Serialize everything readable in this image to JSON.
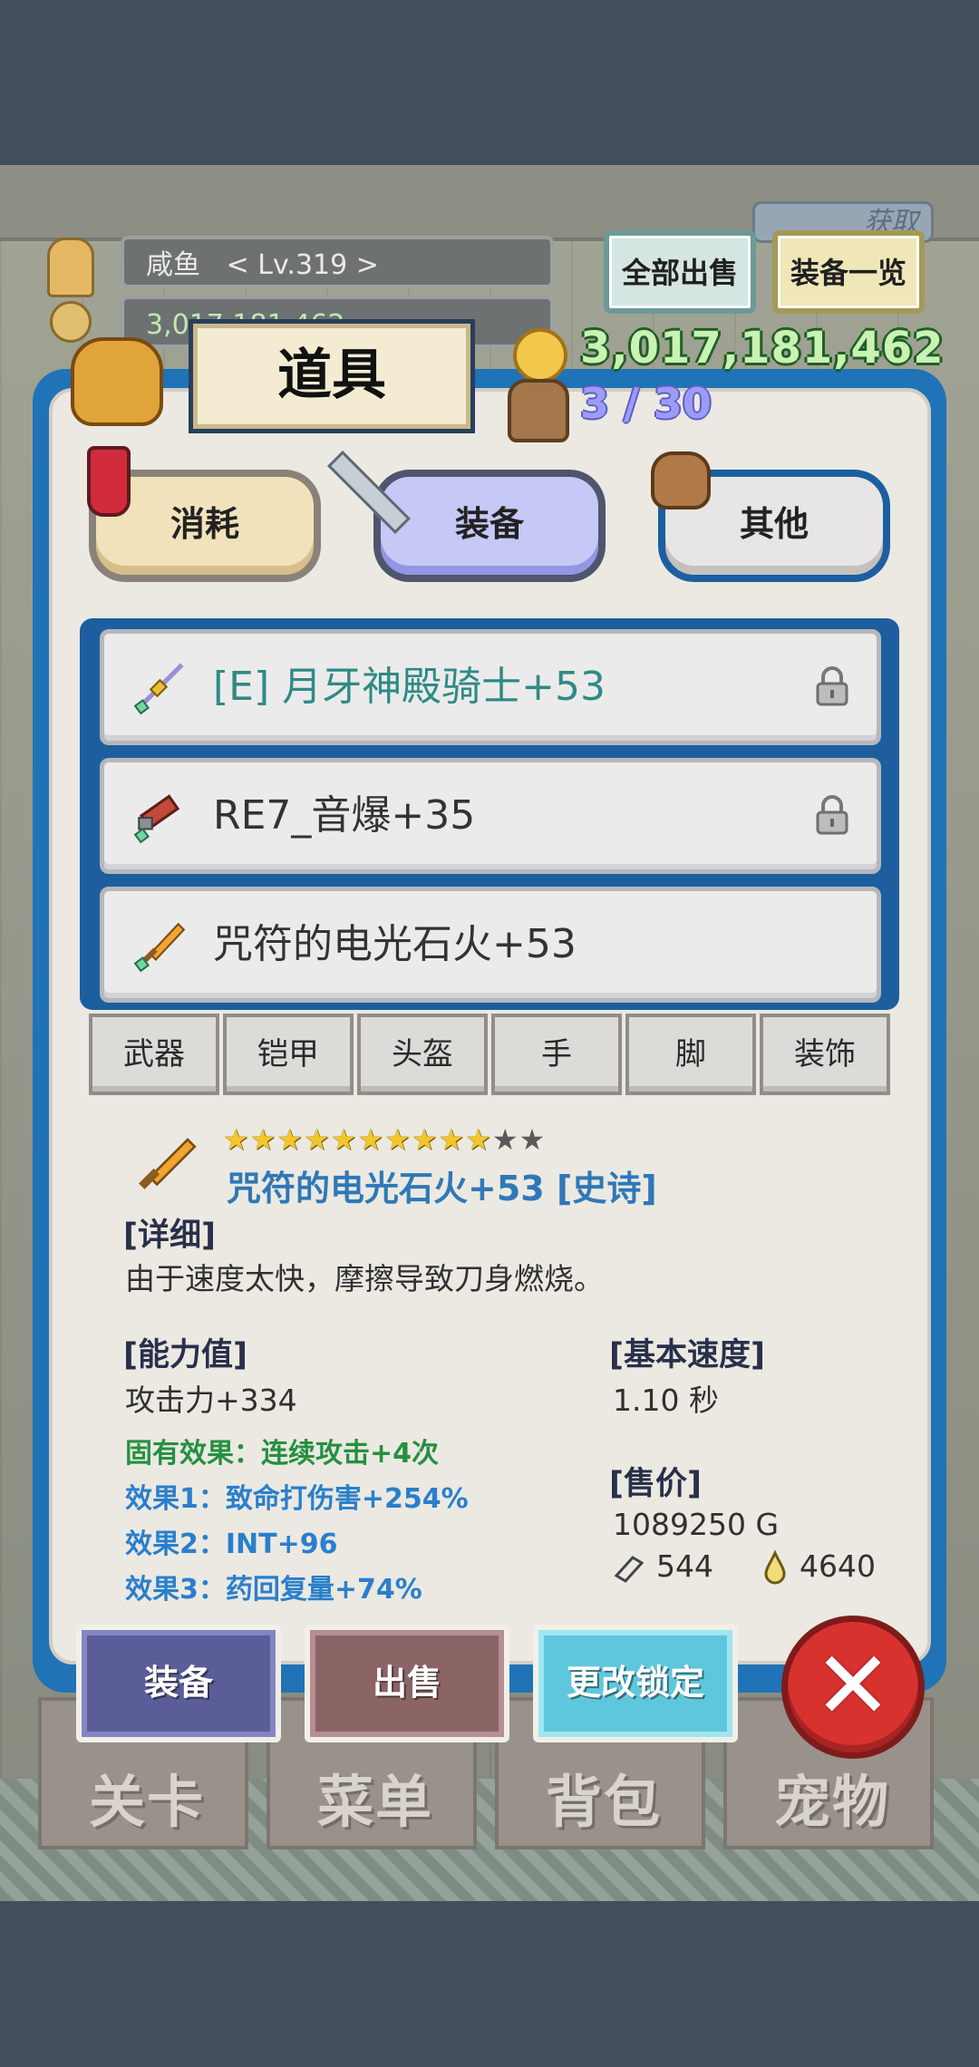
{
  "hud": {
    "player_name": "咸鱼",
    "player_level": "< Lv.319 >",
    "gold_small": "3,017,181,462",
    "corner_tag": "获取",
    "sell_all": "全部出售",
    "equip_list": "装备一览"
  },
  "panel": {
    "title": "道具",
    "gold": "3,017,181,462",
    "bag_count": "3 / 30"
  },
  "category_tabs": [
    "消耗",
    "装备",
    "其他"
  ],
  "selected_category": "装备",
  "items": [
    {
      "name": "[E] 月牙神殿骑士+53",
      "locked": true,
      "equipped": true
    },
    {
      "name": "RE7_音爆+35",
      "locked": true,
      "equipped": false
    },
    {
      "name": "咒符的电光石火+53",
      "locked": false,
      "equipped": false
    }
  ],
  "slot_tabs": [
    "武器",
    "铠甲",
    "头盔",
    "手",
    "脚",
    "装饰"
  ],
  "detail": {
    "stars_filled": 10,
    "stars_total": 12,
    "name": "咒符的电光石火+53 [史诗]",
    "detail_header": "[详细]",
    "description": "由于速度太快，摩擦导致刀身燃烧。",
    "ability_header": "[能力值]",
    "attack": "攻击力+334",
    "innate": "固有效果：连续攻击+4次",
    "effect1": "效果1：致命打伤害+254%",
    "effect2": "效果2：INT+96",
    "effect3": "效果3：药回复量+74%",
    "speed_header": "[基本速度]",
    "speed": "1.10 秒",
    "price_header": "[售价]",
    "price": "1089250 G",
    "material1": "544",
    "material2": "4640"
  },
  "actions": {
    "equip": "装备",
    "sell": "出售",
    "change_lock": "更改锁定"
  },
  "bottom_nav": [
    "关卡",
    "菜单",
    "背包",
    "宠物"
  ],
  "colors": {
    "panel_blue": "#1f73b6",
    "gold_text": "#c9f2b4",
    "item_name_equipped": "#2f8a86",
    "innate_effect": "#259040",
    "random_effect": "#2a7fcb"
  }
}
